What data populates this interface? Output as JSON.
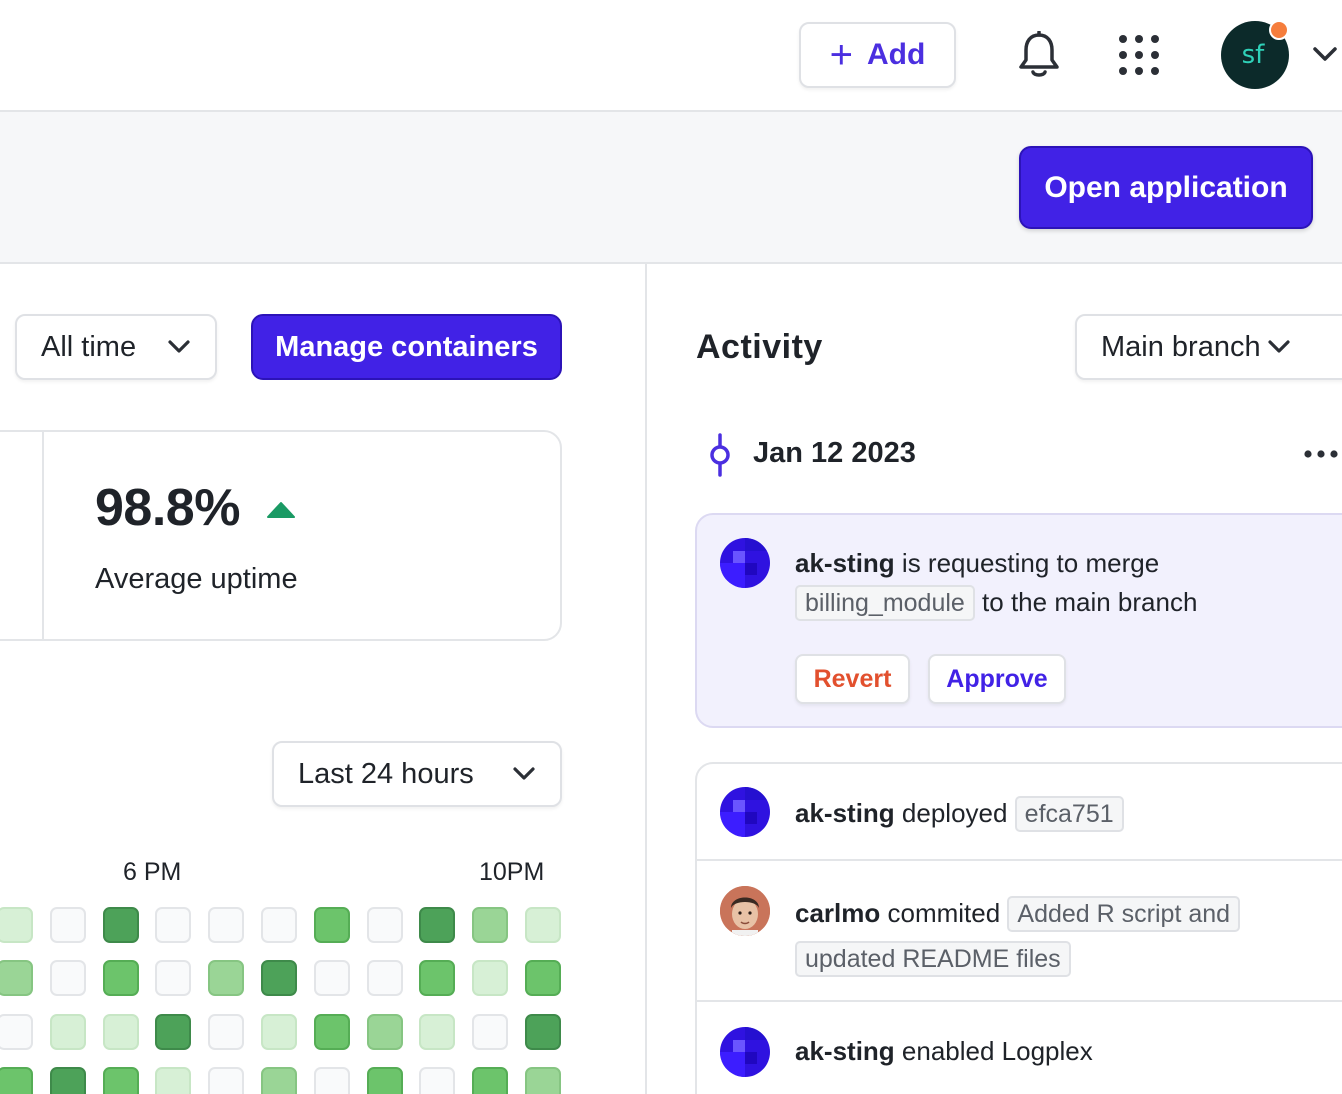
{
  "topbar": {
    "add_label": "Add",
    "add_icon": "plus-icon",
    "bell_icon": "bell-icon",
    "apps_icon": "grid-dots-icon",
    "avatar_text": "sf",
    "avatar_dot_color": "#f57d3c",
    "menu_icon": "chevron-down-icon"
  },
  "subbar": {
    "open_label": "Open application"
  },
  "filters": {
    "range_label": "All time",
    "manage_label": "Manage containers",
    "heatmap_range_label": "Last 24 hours"
  },
  "stat": {
    "value": "98.8%",
    "trend": "up",
    "label": "Average uptime",
    "trend_color": "#1a9a64"
  },
  "heatmap": {
    "time_labels": [
      "6 PM",
      "10PM"
    ],
    "levels": [
      [
        1,
        0,
        4,
        0,
        0,
        0,
        3,
        0,
        4,
        2,
        1
      ],
      [
        2,
        0,
        3,
        0,
        2,
        4,
        0,
        0,
        3,
        1,
        3
      ],
      [
        0,
        1,
        1,
        4,
        0,
        1,
        3,
        2,
        1,
        0,
        4
      ],
      [
        3,
        4,
        3,
        1,
        0,
        2,
        0,
        3,
        0,
        3,
        2
      ]
    ],
    "colors": [
      "#f9fafb",
      "#d7f0d6",
      "#9ad596",
      "#6cc46b",
      "#4da259"
    ]
  },
  "activity": {
    "title": "Activity",
    "branch_label": "Main branch",
    "date": "Jan 12 2023",
    "merge": {
      "user": "ak-sting",
      "text1": " is requesting to merge",
      "branch_chip": "billing_module",
      "text2": " to the main branch",
      "revert_label": "Revert",
      "approve_label": "Approve"
    },
    "items": [
      {
        "user": "ak-sting",
        "verb": " deployed ",
        "chip": "efca751"
      },
      {
        "user": "carlmo",
        "verb": " commited ",
        "chip": "Added R script and",
        "chip2": "updated README files"
      },
      {
        "user": "ak-sting",
        "verb": " enabled Logplex"
      }
    ]
  }
}
